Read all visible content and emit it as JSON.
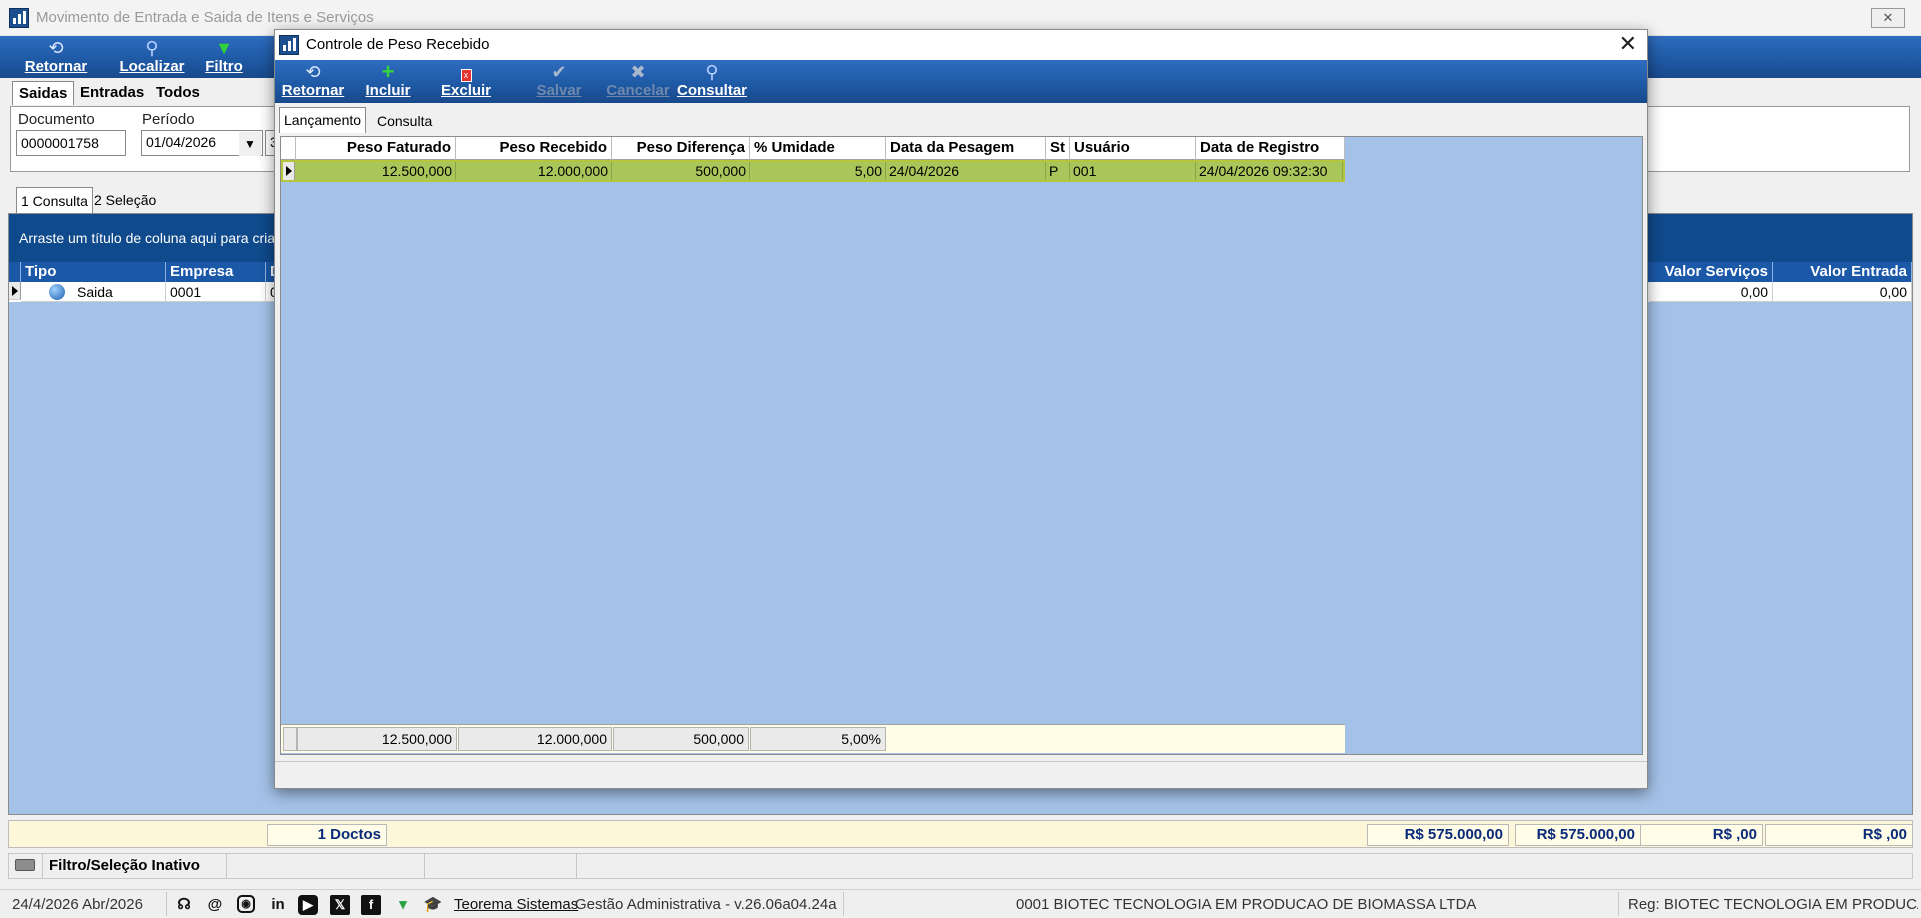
{
  "main": {
    "title": "Movimento de Entrada e Saida de Itens e Serviços",
    "toolbar": {
      "retornar": "Retornar",
      "localizar": "Localizar",
      "filtro": "Filtro"
    },
    "tabs": {
      "saidas": "Saidas",
      "entradas": "Entradas",
      "todos": "Todos"
    },
    "filter": {
      "documento_label": "Documento",
      "documento_value": "0000001758",
      "periodo_label": "Período",
      "periodo_value": "01/04/2026",
      "periodo_end_partial": "3"
    },
    "subtabs": {
      "consulta": "1 Consulta",
      "selecao": "2 Seleção"
    },
    "group_band_text": "Arraste um título de coluna aqui para criar u",
    "grid": {
      "columns": {
        "tipo": "Tipo",
        "empresa": "Empresa",
        "d": "D",
        "valor_servicos": "Valor Serviços",
        "valor_entrada": "Valor Entrada"
      },
      "row": {
        "tipo": "Saida",
        "empresa": "0001",
        "d": "0",
        "valor_servicos": "0,00",
        "valor_entrada": "0,00"
      }
    },
    "totals": {
      "doctos": "1 Doctos",
      "total1": "R$ 575.000,00",
      "total2": "R$ 575.000,00",
      "total3": "R$ ,00",
      "total4": "R$ ,00"
    },
    "status": {
      "filter_state": "Filtro/Seleção Inativo"
    }
  },
  "bottom_status": {
    "date": "24/4/2026 Abr/2026",
    "company_link": "Teorema Sistemas",
    "app_version": "Gestão Administrativa - v.26.06a04.24a",
    "empresa": "0001 BIOTEC TECNOLOGIA EM PRODUCAO DE BIOMASSA LTDA",
    "registro": "Reg: BIOTEC TECNOLOGIA EM PRODUCAO I"
  },
  "dialog": {
    "title": "Controle de Peso Recebido",
    "toolbar": {
      "retornar": "Retornar",
      "incluir": "Incluir",
      "excluir": "Excluir",
      "salvar": "Salvar",
      "cancelar": "Cancelar",
      "consultar": "Consultar"
    },
    "tabs": {
      "lancamento": "Lançamento",
      "consulta": "Consulta"
    },
    "grid": {
      "columns": {
        "peso_faturado": "Peso Faturado",
        "peso_recebido": "Peso Recebido",
        "peso_diferenca": "Peso Diferença",
        "umidade": "% Umidade",
        "data_pesagem": "Data da Pesagem",
        "status": "St",
        "usuario": "Usuário",
        "data_registro": "Data de Registro"
      },
      "row": {
        "peso_faturado": "12.500,000",
        "peso_recebido": "12.000,000",
        "peso_diferenca": "500,000",
        "umidade": "5,00",
        "data_pesagem": "24/04/2026",
        "status": "P",
        "usuario": "001",
        "data_registro": "24/04/2026 09:32:30"
      },
      "footer": {
        "peso_faturado": "12.500,000",
        "peso_recebido": "12.000,000",
        "peso_diferenca": "500,000",
        "umidade": "5,00%"
      }
    }
  },
  "colors": {
    "toolbar_blue": "#1f5aa6",
    "grid_background": "#a4c2e8",
    "selected_row": "#a9c65a",
    "header_blue": "#1b58a8",
    "group_band": "#0f4a8c",
    "totals_text": "#0a2a7a"
  }
}
